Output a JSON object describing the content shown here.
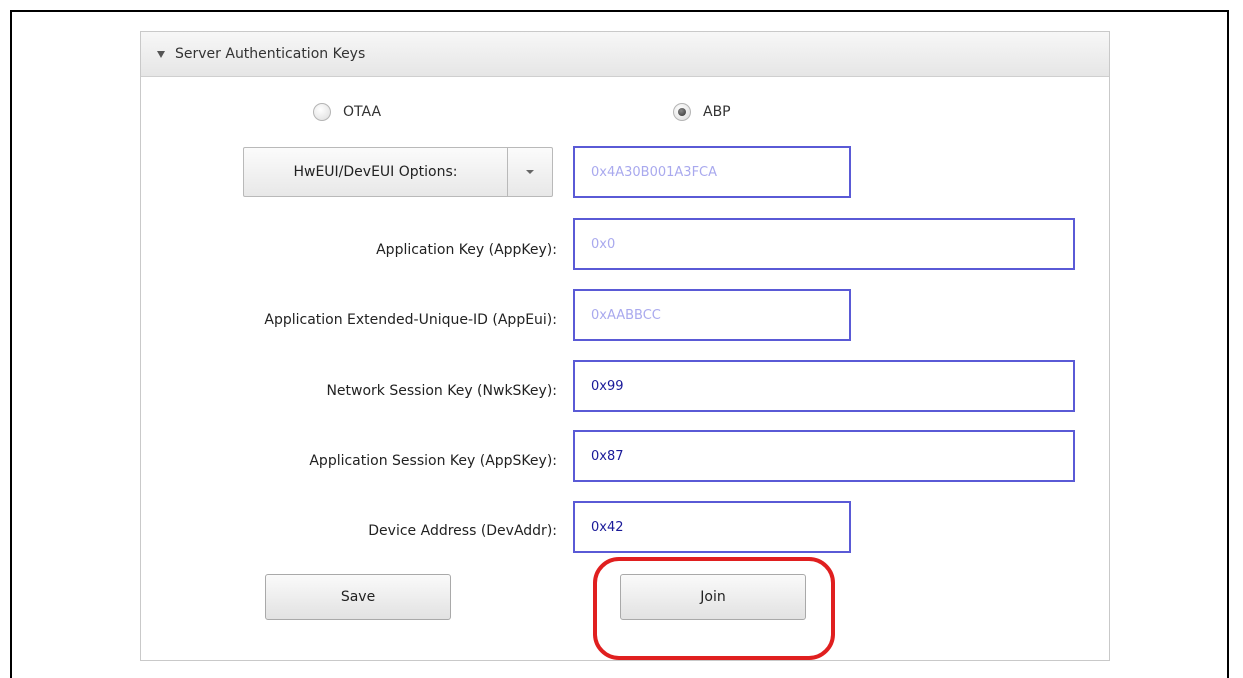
{
  "panel": {
    "title": "Server Authentication Keys"
  },
  "join_mode": {
    "options": [
      {
        "label": "OTAA",
        "selected": false
      },
      {
        "label": "ABP",
        "selected": true
      }
    ]
  },
  "hweui_dropdown": {
    "label": "HwEUI/DevEUI Options:",
    "value": "0x4A30B001A3FCA"
  },
  "fields": {
    "app_key": {
      "label": "Application Key (AppKey):",
      "value": "0x0"
    },
    "app_eui": {
      "label": "Application Extended-Unique-ID (AppEui):",
      "value": "0xAABBCC"
    },
    "nwk_skey": {
      "label": "Network Session Key (NwkSKey):",
      "value": "0x99"
    },
    "app_skey": {
      "label": "Application Session Key (AppSKey):",
      "value": "0x87"
    },
    "dev_addr": {
      "label": "Device Address (DevAddr):",
      "value": "0x42"
    }
  },
  "buttons": {
    "save": "Save",
    "join": "Join"
  },
  "colors": {
    "input_border": "#5a5ad6",
    "highlight": "#e01f1f"
  }
}
